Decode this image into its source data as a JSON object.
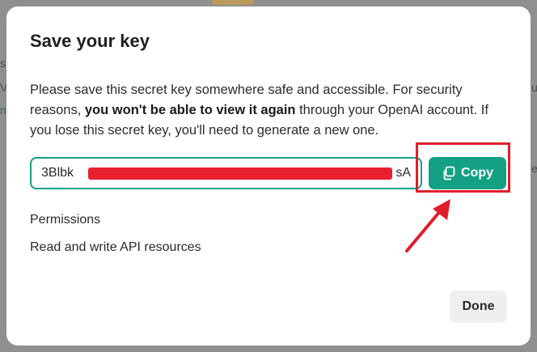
{
  "modal": {
    "title": "Save your key",
    "description_part1": "Please save this secret key somewhere safe and accessible. For security reasons, ",
    "description_bold": "you won't be able to view it again",
    "description_part2": " through your OpenAI account. If you lose this secret key, you'll need to generate a new one.",
    "key_visible_start": "3Blbk",
    "key_visible_end": "sA",
    "copy_label": "Copy",
    "permissions_label": "Permissions",
    "permissions_value": "Read and write API resources",
    "done_label": "Done"
  },
  "background_fragments": {
    "left_1": "s",
    "left_2": "V",
    "left_3": "n",
    "right_1": "u",
    "right_2": "e"
  },
  "colors": {
    "accent": "#13a083",
    "highlight": "#e01e2b",
    "redaction": "#e8202e"
  },
  "icons": {
    "copy": "copy-icon",
    "annotation": "red-arrow-icon"
  }
}
